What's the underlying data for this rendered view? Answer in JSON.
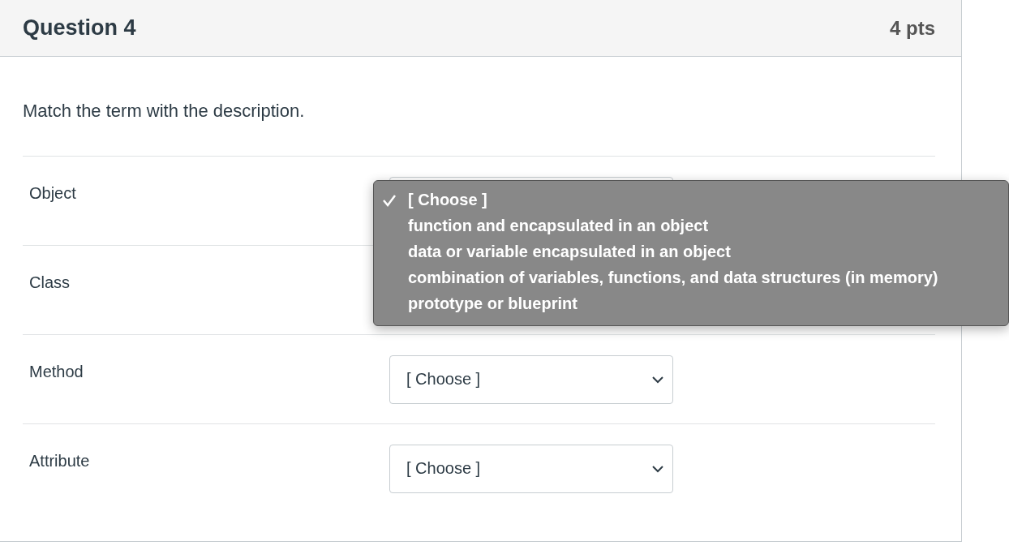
{
  "header": {
    "title": "Question 4",
    "points": "4 pts"
  },
  "prompt": "Match the term with the description.",
  "rows": [
    {
      "term": "Object",
      "open": true
    },
    {
      "term": "Class",
      "open": false
    },
    {
      "term": "Method",
      "open": false,
      "value": "[ Choose ]"
    },
    {
      "term": "Attribute",
      "open": false,
      "value": "[ Choose ]"
    }
  ],
  "menu": {
    "options": [
      {
        "label": "[ Choose ]",
        "selected": true
      },
      {
        "label": "function and encapsulated in an object",
        "selected": false
      },
      {
        "label": "data or variable encapsulated in an object",
        "selected": false
      },
      {
        "label": "combination of variables, functions, and data structures (in memory)",
        "selected": false
      },
      {
        "label": "prototype or blueprint",
        "selected": false
      }
    ]
  }
}
